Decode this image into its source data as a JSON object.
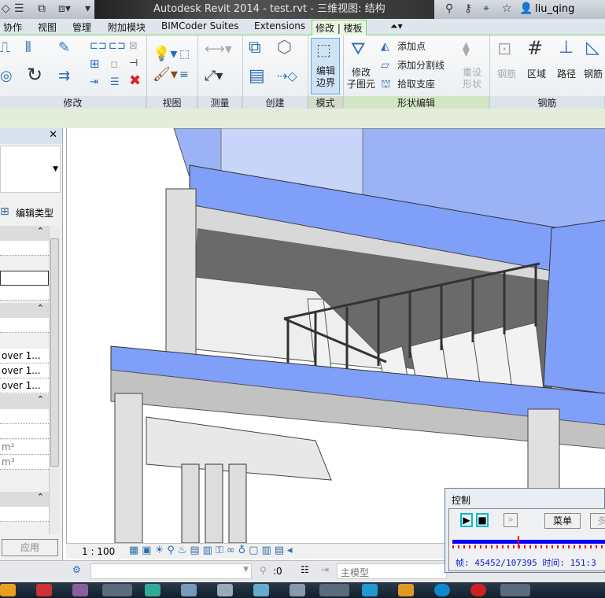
{
  "titlebar": {
    "title": "Autodesk Revit 2014 -    test.rvt - 三维视图: 结构",
    "user": "liu_qing"
  },
  "tabs": [
    "协作",
    "视图",
    "管理",
    "附加模块",
    "BIMCoder Suites",
    "Extensions",
    "修改 | 楼板"
  ],
  "ribbon": {
    "panels": [
      "修改",
      "视图",
      "测量",
      "创建",
      "模式",
      "形状编辑",
      "钢筋"
    ],
    "edit_boundary": "编辑\n边界",
    "modify_sub": "修改\n子图元",
    "add_point": "添加点",
    "add_split_line": "添加分割线",
    "pick_supports": "拾取支座",
    "reset_shape": "重设\n形状",
    "rebar": [
      "钢筋",
      "区域",
      "路径",
      "钢筋"
    ]
  },
  "properties": {
    "edit_type": "编辑类型",
    "rows": [
      "",
      "",
      "",
      "",
      "over 1...",
      "over 1...",
      "over 1...",
      "",
      "",
      "m²",
      "m³",
      ""
    ],
    "apply": "应用"
  },
  "view_control": {
    "scale": "1 : 100"
  },
  "status": {
    "worksets": ":0",
    "model": "主模型"
  },
  "control": {
    "title": "控制",
    "menu": "菜单",
    "more": "多",
    "frame_label": "帧: 45452/107395 时间: 151:3",
    "progress": 0.423,
    "colors": {
      "bar": "#0000ff",
      "marker": "#ff0000"
    }
  },
  "colors": {
    "accent": "#7bd36c",
    "slab": "#7f9ff8"
  }
}
